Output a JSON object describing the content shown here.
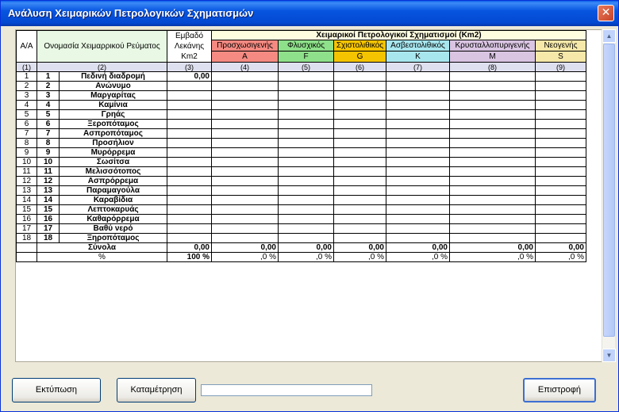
{
  "window": {
    "title": "Ανάλυση Χειμαρικών Πετρολογικών Σχηματισμών",
    "close": "✕"
  },
  "headers": {
    "aa": "Α/Α",
    "name": "Ονομασία Χειμαρρικού Ρεύματος",
    "area": "Εμβαδό Λεκάνης Km2",
    "group": "Χειμαρικοί Πετρολογικοί Σχηματισμοί (Km2)",
    "cols": [
      {
        "label": "Προσχωσιγενής",
        "code": "A"
      },
      {
        "label": "Φλυσχικός",
        "code": "F"
      },
      {
        "label": "Σχιστολιθικός",
        "code": "G"
      },
      {
        "label": "Ασβεστολιθικός",
        "code": "K"
      },
      {
        "label": "Κρυσταλλοπυριγενής",
        "code": "M"
      },
      {
        "label": "Νεογενής",
        "code": "S"
      }
    ],
    "numbers": [
      "(1)",
      "(2)",
      "(3)",
      "(4)",
      "(5)",
      "(6)",
      "(7)",
      "(8)",
      "(9)"
    ]
  },
  "rows": [
    {
      "aa": "1",
      "id": "1",
      "name": "Πεδινή διαδρομή",
      "area": "0,00"
    },
    {
      "aa": "2",
      "id": "2",
      "name": "Ανώνυμο",
      "area": ""
    },
    {
      "aa": "3",
      "id": "3",
      "name": "Μαργαρίτας",
      "area": ""
    },
    {
      "aa": "4",
      "id": "4",
      "name": "Καμίνια",
      "area": ""
    },
    {
      "aa": "5",
      "id": "5",
      "name": "Γρηάς",
      "area": ""
    },
    {
      "aa": "6",
      "id": "6",
      "name": "Ξεροπόταμος",
      "area": ""
    },
    {
      "aa": "7",
      "id": "7",
      "name": "Ασπροπόταμος",
      "area": ""
    },
    {
      "aa": "8",
      "id": "8",
      "name": "Προσήλιον",
      "area": ""
    },
    {
      "aa": "9",
      "id": "9",
      "name": "Μυρόρρεμα",
      "area": ""
    },
    {
      "aa": "10",
      "id": "10",
      "name": "Σωσίτσα",
      "area": ""
    },
    {
      "aa": "11",
      "id": "11",
      "name": "Μελισσότοπος",
      "area": ""
    },
    {
      "aa": "12",
      "id": "12",
      "name": "Ασπρόρρεμα",
      "area": ""
    },
    {
      "aa": "13",
      "id": "13",
      "name": "Παραμαγούλα",
      "area": ""
    },
    {
      "aa": "14",
      "id": "14",
      "name": "Καραβίδια",
      "area": ""
    },
    {
      "aa": "15",
      "id": "15",
      "name": "Λεπτοκαρυάς",
      "area": ""
    },
    {
      "aa": "16",
      "id": "16",
      "name": "Καθαρόρρεμα",
      "area": ""
    },
    {
      "aa": "17",
      "id": "17",
      "name": "Βαθύ νερό",
      "area": ""
    },
    {
      "aa": "18",
      "id": "18",
      "name": "Ξηροπόταμος",
      "area": ""
    }
  ],
  "totals": {
    "label": "Σύνολα",
    "area": "0,00",
    "values": [
      "0,00",
      "0,00",
      "0,00",
      "0,00",
      "0,00",
      "0,00"
    ]
  },
  "percent": {
    "label": "%",
    "area": "100 %",
    "values": [
      ",0 %",
      ",0 %",
      ",0 %",
      ",0 %",
      ",0 %",
      ",0 %"
    ]
  },
  "buttons": {
    "print": "Εκτύπωση",
    "count": "Καταμέτρηση",
    "back": "Επιστροφή"
  },
  "scroll": {
    "up": "▲",
    "down": "▼"
  },
  "colors": {
    "A": "#f48a82",
    "F": "#8ee08a",
    "G": "#f5c400",
    "K": "#a8e6ee",
    "M": "#d9c4e2",
    "S": "#f5e8a8"
  }
}
